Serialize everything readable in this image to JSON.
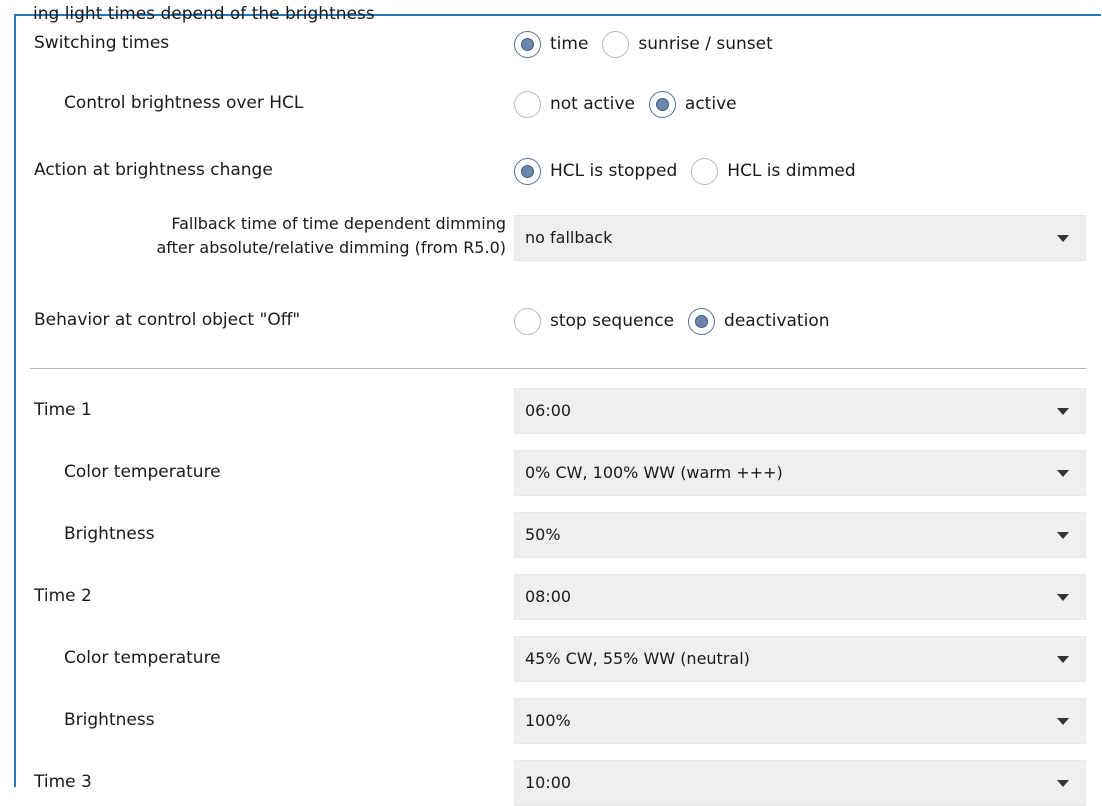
{
  "header_partial_text": "ing light times depend of the brightness",
  "switching_times": {
    "label": "Switching times",
    "options": [
      "time",
      "sunrise / sunset"
    ],
    "selected": 0
  },
  "control_brightness": {
    "label": "Control brightness over HCL",
    "options": [
      "not active",
      "active"
    ],
    "selected": 1
  },
  "action_brightness": {
    "label": "Action at brightness change",
    "options": [
      "HCL is stopped",
      "HCL is dimmed"
    ],
    "selected": 0
  },
  "fallback": {
    "label_line1": "Fallback time of time dependent dimming",
    "label_line2": "after absolute/relative dimming (from R5.0)",
    "value": "no fallback"
  },
  "behavior_off": {
    "label": "Behavior at control object \"Off\"",
    "options": [
      "stop sequence",
      "deactivation"
    ],
    "selected": 1
  },
  "times": [
    {
      "label": "Time 1",
      "time_value": "06:00",
      "color_label": "Color temperature",
      "color_value": "0% CW, 100% WW (warm +++)",
      "brightness_label": "Brightness",
      "brightness_value": "50%"
    },
    {
      "label": "Time 2",
      "time_value": "08:00",
      "color_label": "Color temperature",
      "color_value": "45% CW, 55% WW (neutral)",
      "brightness_label": "Brightness",
      "brightness_value": "100%"
    },
    {
      "label": "Time 3",
      "time_value": "10:00"
    }
  ]
}
